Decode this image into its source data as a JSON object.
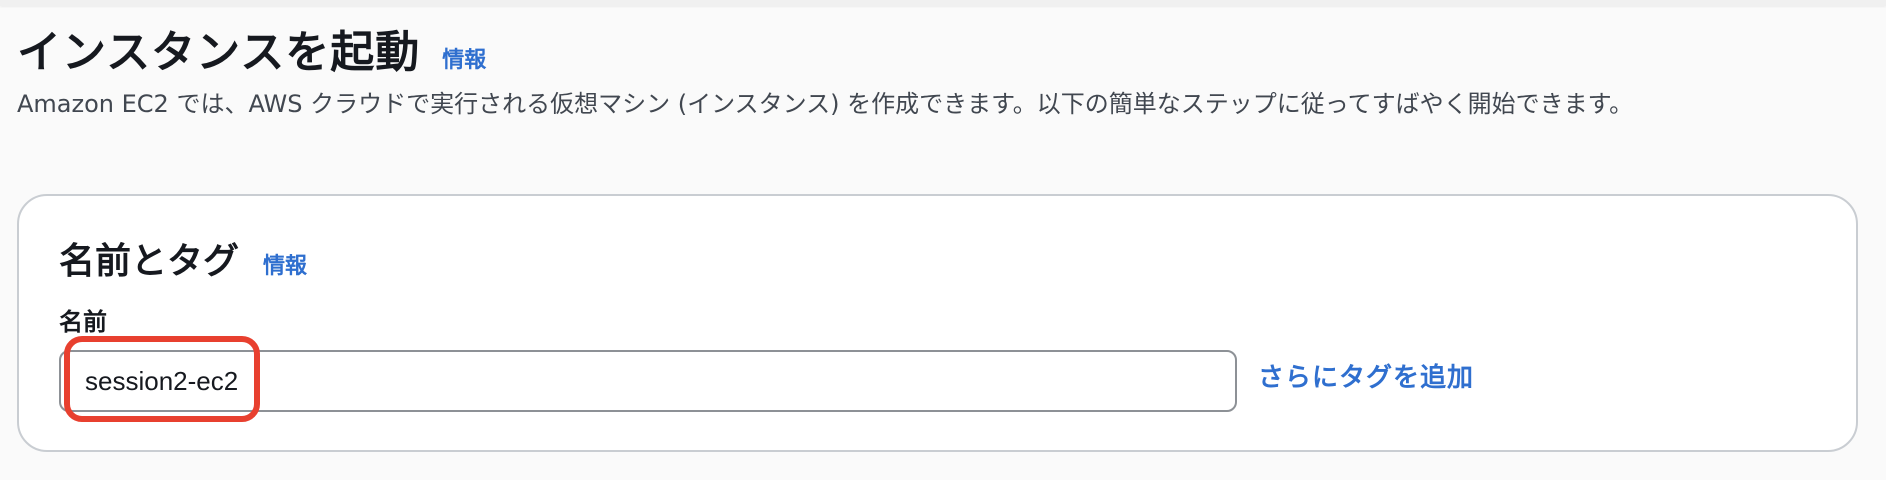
{
  "header": {
    "title": "インスタンスを起動",
    "info_label": "情報",
    "description": "Amazon EC2 では、AWS クラウドで実行される仮想マシン (インスタンス) を作成できます。以下の簡単なステップに従ってすばやく開始できます。"
  },
  "name_and_tags": {
    "title": "名前とタグ",
    "info_label": "情報",
    "name_label": "名前",
    "name_value": "session2-ec2",
    "add_tags_label": "さらにタグを追加"
  },
  "colors": {
    "link": "#2f6fcf",
    "highlight": "#e8402f",
    "border": "#c9cdd2"
  }
}
